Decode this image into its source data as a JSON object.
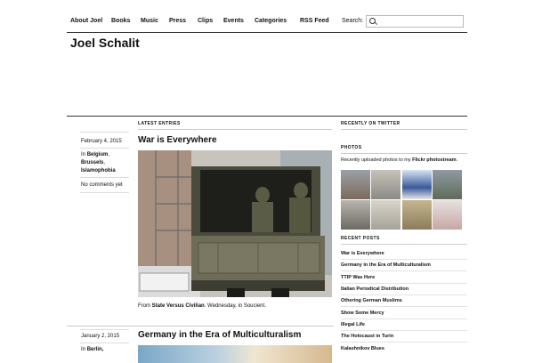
{
  "nav": {
    "items": [
      "About Joel",
      "Books",
      "Music",
      "Press",
      "Clips",
      "Events",
      "Categories",
      "RSS Feed"
    ],
    "search_label": "Search:",
    "search_value": ""
  },
  "site": {
    "title": "Joel Schalit"
  },
  "main": {
    "section_label": "LATEST ENTRIES",
    "posts": [
      {
        "date": "February 4, 2015",
        "in_label": "In",
        "categories": [
          "Belgium",
          "Brussels",
          "Islamophobia"
        ],
        "comments": "No comments yet",
        "title": "War is Everywhere",
        "caption_prefix": "From",
        "caption_link": "State Versus Civilian",
        "caption_suffix": ". Wednesday, in Soucient."
      },
      {
        "date": "January 2, 2015",
        "in_label": "In",
        "categories": [
          "Berlin,"
        ],
        "title": "Germany in the Era of Multiculturalism"
      }
    ]
  },
  "sidebar": {
    "recently_label": "RECENTLY ON TWITTER",
    "photos_label": "PHOTOS",
    "photos_text_prefix": "Recently uploaded photos to my ",
    "photos_link": "Flickr photostream",
    "photos_text_suffix": ".",
    "recent_label": "RECENT POSTS",
    "recent_posts": [
      "War is Everywhere",
      "Germany in the Era of Multiculturalism",
      "TTIP Was Here",
      "Italian Periodical Distribution",
      "Othering German Muslims",
      "Show Some Mercy",
      "Illegal Life",
      "The Holocaust in Turin",
      "Kalashnikov Blues"
    ]
  },
  "colors": {
    "text": "#111111",
    "rule": "#333333"
  }
}
